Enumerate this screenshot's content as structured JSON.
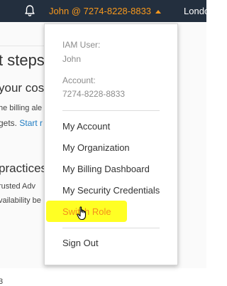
{
  "topbar": {
    "account_label": "John @ 7274-8228-8833",
    "region_label": "Londo"
  },
  "background": {
    "heading1": "t steps",
    "heading2": "your cost",
    "text1": "he billing ale",
    "text2_prefix": "gets. ",
    "text2_link": "Start r",
    "heading3": "practices",
    "text3": "rusted Adv",
    "text4": "vailability be",
    "text5": "3"
  },
  "dropdown": {
    "iam_user_label": "IAM User:",
    "iam_user_value": "John",
    "account_label": "Account:",
    "account_value": "7274-8228-8833",
    "items": [
      {
        "label": "My Account"
      },
      {
        "label": "My Organization"
      },
      {
        "label": "My Billing Dashboard"
      },
      {
        "label": "My Security Credentials"
      },
      {
        "label": "Switch Role"
      },
      {
        "label": "Sign Out"
      }
    ]
  },
  "colors": {
    "topbar_bg": "#232f3e",
    "accent_orange": "#f7981d",
    "highlight_yellow": "#ffff24"
  },
  "icons": {
    "bell": "bell-icon",
    "caret": "caret-up-icon",
    "cursor": "hand-cursor-icon"
  }
}
